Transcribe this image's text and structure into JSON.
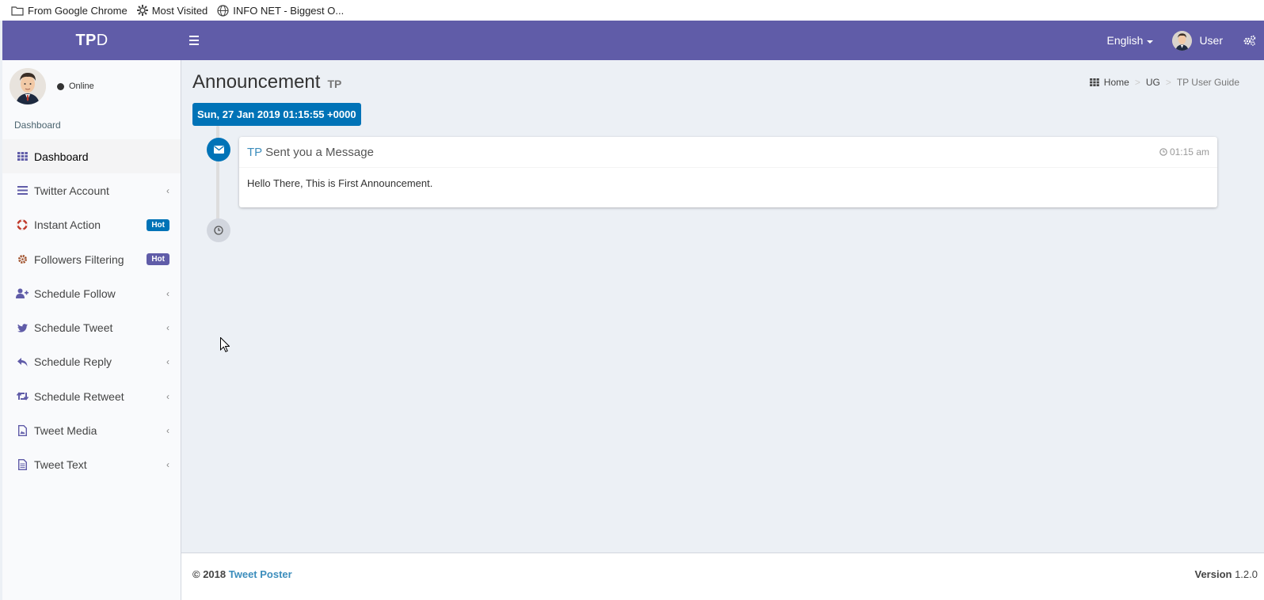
{
  "bookmarks": [
    {
      "label": "From Google Chrome",
      "icon": "folder-icon"
    },
    {
      "label": "Most Visited",
      "icon": "gear-icon"
    },
    {
      "label": "INFO NET - Biggest O...",
      "icon": "globe-icon"
    }
  ],
  "header": {
    "logo_bold": "TP",
    "logo_light": "D",
    "language": "English",
    "user": "User",
    "accent_color": "#605ca8"
  },
  "sidebar": {
    "status": "Online",
    "section_header": "Dashboard",
    "items": [
      {
        "label": "Dashboard",
        "icon": "grid-icon",
        "active": true
      },
      {
        "label": "Twitter Account",
        "icon": "bars-icon"
      },
      {
        "label": "Instant Action",
        "icon": "life-ring-icon",
        "badge": "Hot"
      },
      {
        "label": "Followers Filtering",
        "icon": "cog-icon",
        "badge": "Hot"
      },
      {
        "label": "Schedule Follow",
        "icon": "user-plus-icon"
      },
      {
        "label": "Schedule Tweet",
        "icon": "twitter-icon"
      },
      {
        "label": "Schedule Reply",
        "icon": "reply-icon"
      },
      {
        "label": "Schedule Retweet",
        "icon": "retweet-icon"
      },
      {
        "label": "Tweet Media",
        "icon": "file-image-icon"
      },
      {
        "label": "Tweet Text",
        "icon": "file-text-icon"
      }
    ]
  },
  "content": {
    "title": "Announcement",
    "subtitle": "TP",
    "breadcrumb": [
      "Home",
      "UG",
      "TP User Guide"
    ],
    "time_label": "Sun, 27 Jan 2019 01:15:55 +0000",
    "message": {
      "from": "TP",
      "header": "Sent you a Message",
      "time": "01:15 am",
      "body": "Hello There, This is First Announcement."
    }
  },
  "footer": {
    "copyright": "© 2018",
    "brand": "Tweet Poster",
    "version_label": "Version",
    "version": "1.2.0"
  }
}
